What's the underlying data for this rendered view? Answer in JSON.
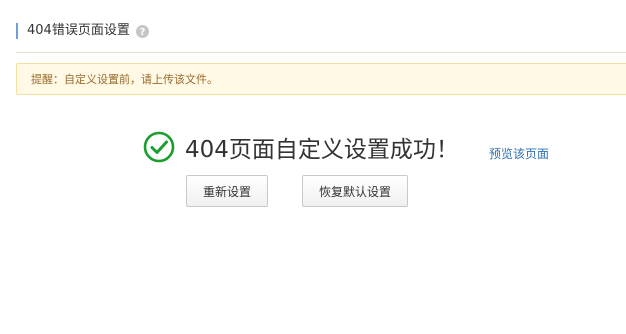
{
  "header": {
    "title": "404错误页面设置",
    "help_icon": "question-circle-icon"
  },
  "notice": {
    "text": "提醒：自定义设置前，请上传该文件。"
  },
  "result": {
    "icon": "check-circle-icon",
    "message": "404页面自定义设置成功！",
    "preview_link": "预览该页面"
  },
  "actions": {
    "reset_label": "重新设置",
    "restore_label": "恢复默认设置"
  },
  "colors": {
    "accent_bar": "#6ea0d8",
    "success_green": "#1a9e2e",
    "link_blue": "#2f6fb3",
    "notice_bg": "#fff9e6",
    "notice_text": "#9a6a2c"
  }
}
